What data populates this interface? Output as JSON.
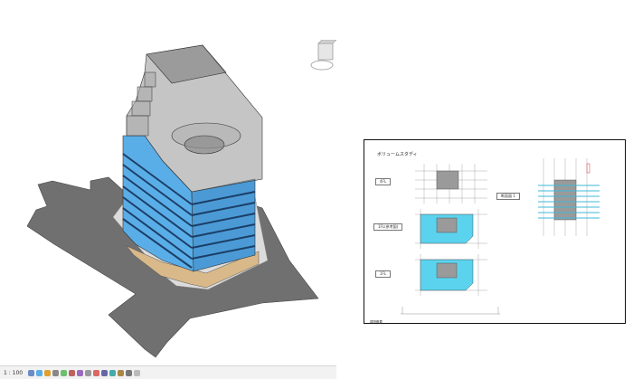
{
  "statusbar": {
    "scale": "1 : 100"
  },
  "sheet": {
    "title": "ボリュームスタディ",
    "tags": {
      "plan_4f": "4FL",
      "plan_1f": "1FL(参考図)",
      "plan_1f_b": "1FL",
      "elevation": "断面図 1"
    },
    "titleblock": "建物概要"
  },
  "colors": {
    "glass": "#5aaee8",
    "plan_cyan": "#5cd3ee",
    "core_gray": "#9a9a9a",
    "ground": "#6e6e6e",
    "podium": "#d9b98a"
  }
}
